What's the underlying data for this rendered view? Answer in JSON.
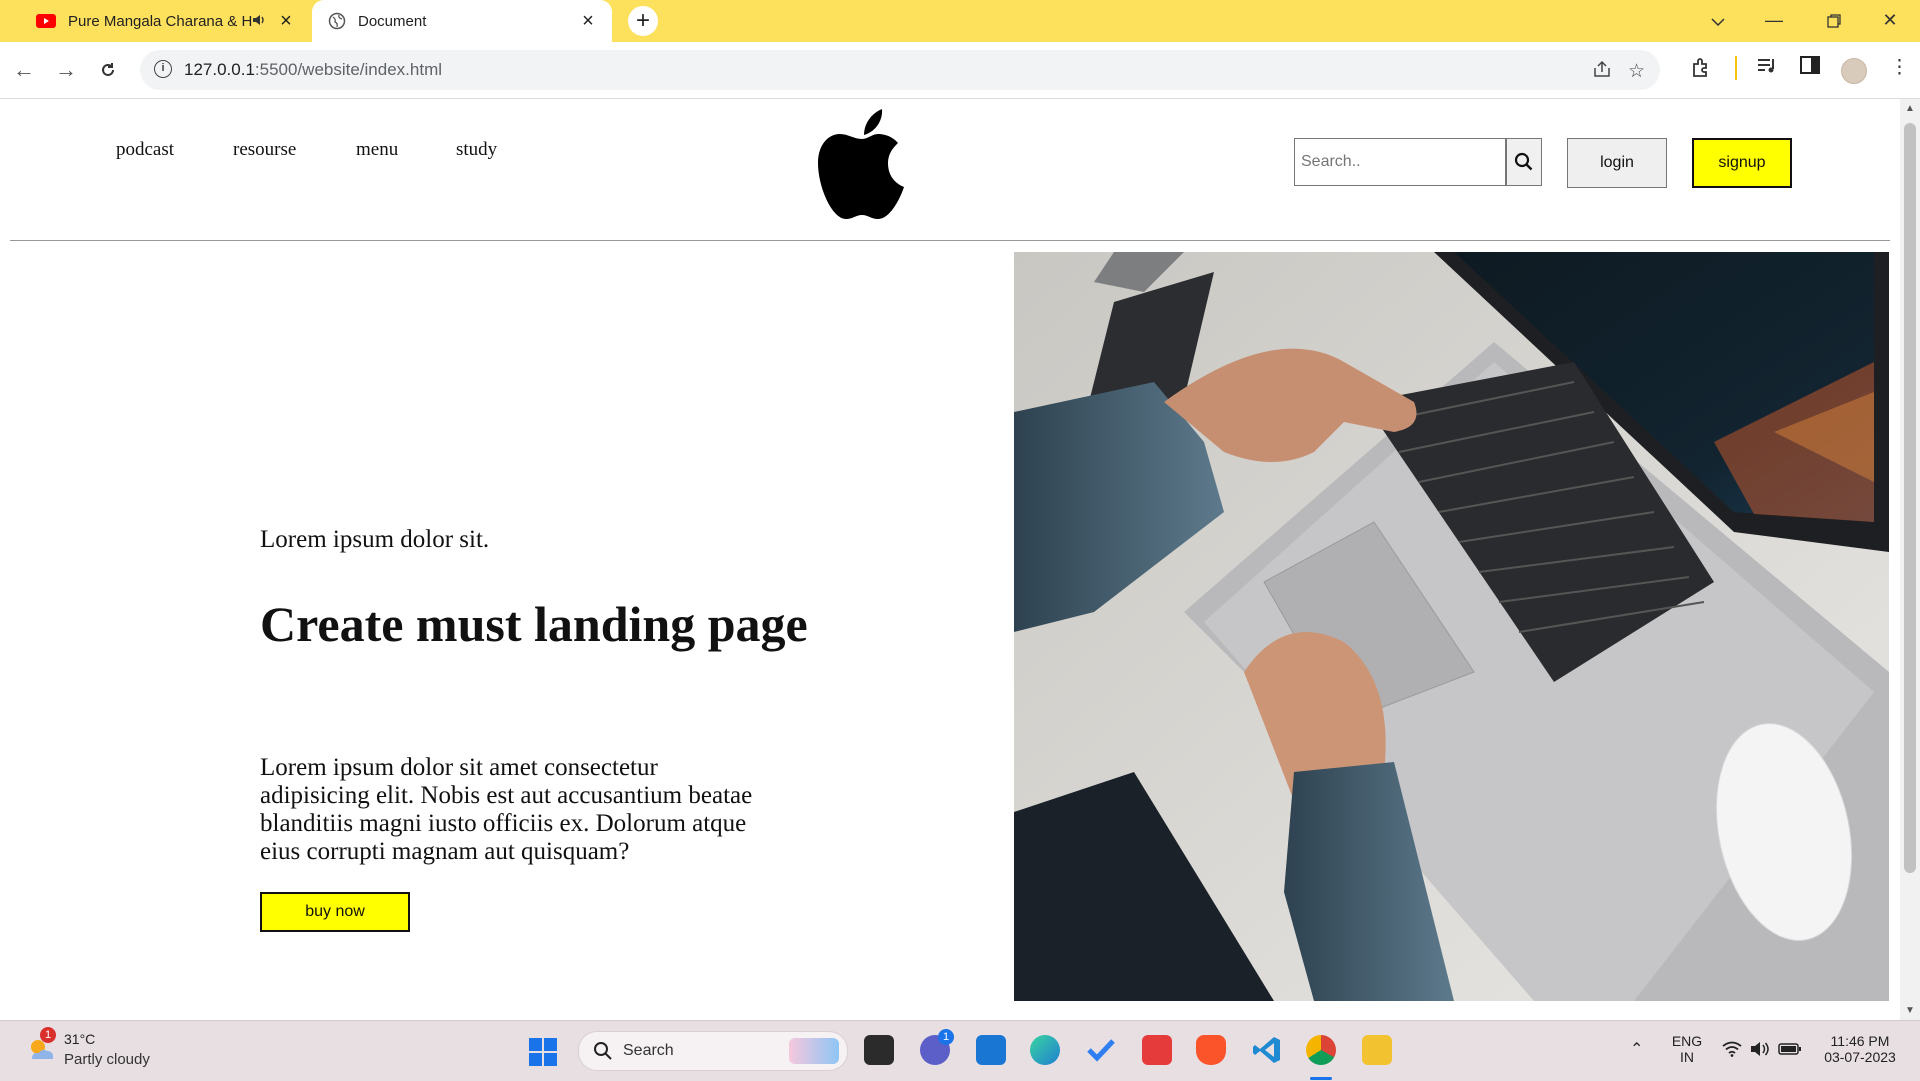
{
  "browser": {
    "tabs": [
      {
        "title": "Pure Mangala Charana & H",
        "active": false
      },
      {
        "title": "Document",
        "active": true
      }
    ],
    "url_host": "127.0.0.1",
    "url_path": ":5500/website/index.html"
  },
  "site": {
    "nav": [
      "podcast",
      "resourse",
      "menu",
      "study"
    ],
    "search_placeholder": "Search..",
    "login_label": "login",
    "signup_label": "signup",
    "eyebrow": "Lorem ipsum dolor sit.",
    "headline": "Create must landing page",
    "body": "Lorem ipsum dolor sit amet consectetur adipisicing elit. Nobis est aut accusantium beatae blanditiis magni iusto officiis ex. Dolorum atque eius corrupti magnam aut quisquam?",
    "cta_label": "buy now"
  },
  "taskbar": {
    "weather_temp": "31°C",
    "weather_desc": "Partly cloudy",
    "weather_badge": "1",
    "search_label": "Search",
    "teams_badge": "1",
    "lang_line1": "ENG",
    "lang_line2": "IN",
    "time": "11:46 PM",
    "date": "03-07-2023"
  },
  "colors": {
    "tab_strip": "#fde05c",
    "accent_yellow": "#ffff00"
  }
}
